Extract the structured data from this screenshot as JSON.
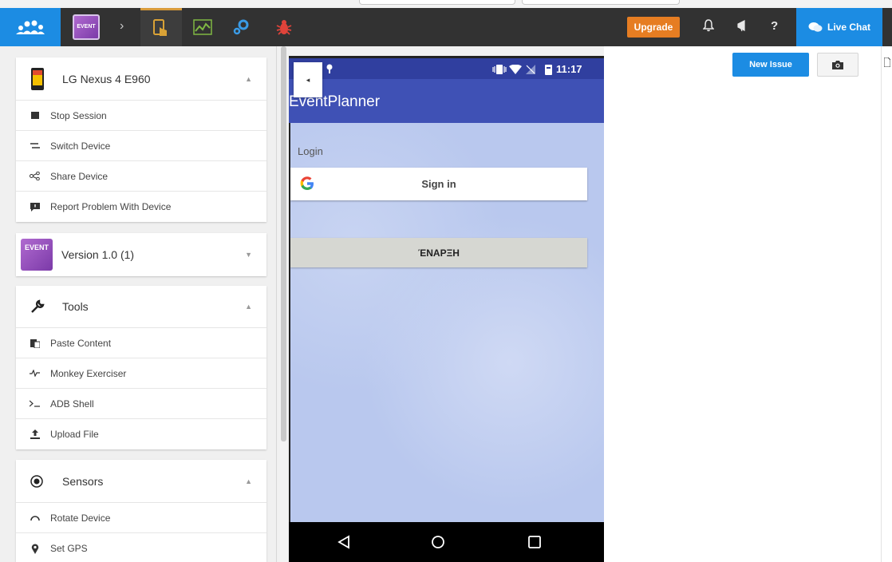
{
  "topbar": {
    "app_thumb_text": "EVENT",
    "crumb_separator": "›",
    "upgrade_label": "Upgrade",
    "bell_glyph": "🔔",
    "megaphone_glyph": "📣",
    "help_glyph": "?",
    "live_chat_label": "Live Chat",
    "accent_color": "#1c8ce3",
    "upgrade_color": "#e67d22"
  },
  "device_card": {
    "title": "LG Nexus 4 E960",
    "chevron": "▲",
    "items": [
      {
        "label": "Stop Session",
        "icon": "stop-icon"
      },
      {
        "label": "Switch Device",
        "icon": "switch-icon"
      },
      {
        "label": "Share Device",
        "icon": "share-icon"
      },
      {
        "label": "Report Problem With Device",
        "icon": "report-icon"
      }
    ]
  },
  "version_card": {
    "title": "Version 1.0 (1)",
    "thumb_text": "EVENT",
    "chevron": "▼"
  },
  "tools_card": {
    "title": "Tools",
    "chevron": "▲",
    "items": [
      {
        "label": "Paste Content",
        "icon": "paste-icon"
      },
      {
        "label": "Monkey Exerciser",
        "icon": "monkey-icon"
      },
      {
        "label": "ADB Shell",
        "icon": "terminal-icon"
      },
      {
        "label": "Upload File",
        "icon": "upload-icon"
      }
    ]
  },
  "sensors_card": {
    "title": "Sensors",
    "chevron": "▲",
    "items": [
      {
        "label": "Rotate Device",
        "icon": "rotate-icon"
      },
      {
        "label": "Set GPS",
        "icon": "gps-icon"
      }
    ]
  },
  "phone": {
    "time": "11:17",
    "app_title": "EventPlanner",
    "login_label": "Login",
    "signin_label": "Sign in",
    "greek_button_label": "ΈΝΑΡΞΗ",
    "collapse_glyph": "◂"
  },
  "right": {
    "new_issue_label": "New Issue"
  }
}
